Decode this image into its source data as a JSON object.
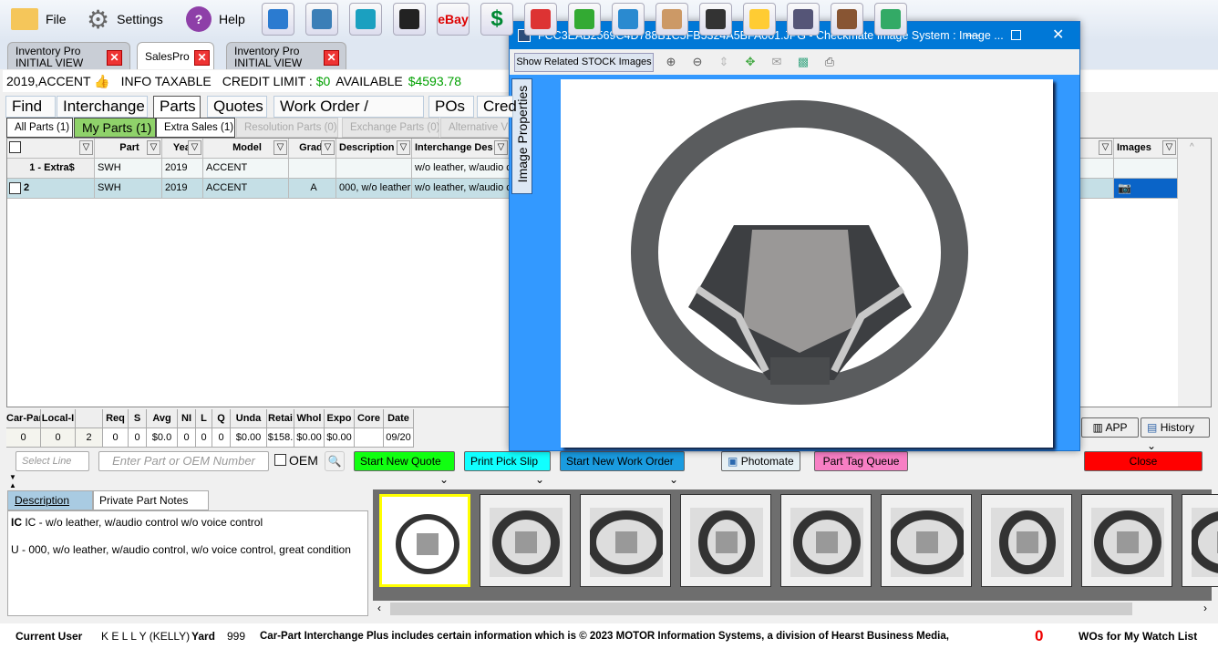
{
  "menu": {
    "file": "File",
    "settings": "Settings",
    "help": "Help"
  },
  "toolbar_icons": [
    "navigator-icon",
    "chart-icon",
    "images-icon",
    "terminal-icon",
    "ebay-icon",
    "dollar-icon",
    "red-app-icon",
    "green-app-icon",
    "report-icon",
    "agent-icon",
    "school-icon",
    "lock-icon",
    "register-icon",
    "clipboard-icon",
    "refresh-icon"
  ],
  "toolbar_text": {
    "ebay": "eBay",
    "dollar": "$"
  },
  "window_tabs": [
    {
      "line1": "Inventory Pro",
      "line2": "INITIAL VIEW"
    },
    {
      "line1": "SalesPro",
      "line2": ""
    },
    {
      "line1": "Inventory Pro",
      "line2": "INITIAL VIEW"
    }
  ],
  "info": {
    "vehicle": "2019,ACCENT",
    "taxable": "INFO TAXABLE",
    "credit_label": "CREDIT LIMIT :",
    "credit": "$0",
    "available_label": "AVAILABLE",
    "available": "$4593.78",
    "money_color": "#00a000"
  },
  "main_tabs": [
    "Find",
    "Interchange",
    "Parts",
    "Quotes",
    "Work Order / Invoice",
    "POs",
    "Cred"
  ],
  "sub_tabs": [
    "All Parts (1)",
    "My Parts (1)",
    "Extra Sales (1)",
    "Resolution Parts (0)",
    "Exchange Parts (0)",
    "Alternative Ve"
  ],
  "grid": {
    "headers": [
      "",
      "Part",
      "Year",
      "Model",
      "Grade",
      "Description",
      "Interchange Des",
      "nge",
      "Images"
    ],
    "rows": [
      [
        "1 - Extra$",
        "SWH",
        "2019",
        "ACCENT",
        "",
        "",
        "w/o leather, w/audio c",
        "",
        ""
      ],
      [
        "2",
        "SWH",
        "2019",
        "ACCENT",
        "A",
        "000, w/o leather",
        "w/o leather, w/audio c",
        "",
        ""
      ]
    ]
  },
  "stats": {
    "headers": [
      "Car-Part",
      "Local-I",
      "",
      "Req",
      "S",
      "Avg",
      "NI",
      "L",
      "Q",
      "Unda",
      "Retai",
      "Whol",
      "Expo",
      "Core",
      "Date"
    ],
    "values": [
      "0",
      "0",
      "2",
      "0",
      "0",
      "$0.0",
      "0",
      "0",
      "0",
      "$0.00",
      "$158.",
      "$0.00",
      "$0.00",
      "",
      "09/20"
    ]
  },
  "controls": {
    "select_line": "Select Line",
    "part_placeholder": "Enter Part or OEM Number",
    "oem": "OEM",
    "start_quote": "Start New Quote",
    "pick_slip": "Print Pick Slip",
    "work_order": "Start New Work Order",
    "photomate": "Photomate",
    "part_tag": "Part Tag Queue",
    "close": "Close",
    "app": "APP",
    "history": "History"
  },
  "desc_tabs": [
    "Description",
    "Private Part Notes"
  ],
  "description": {
    "ic": "IC - w/o leather, w/audio control w/o voice control",
    "u": "U - 000, w/o leather, w/audio control, w/o voice control, great condition"
  },
  "status": {
    "user_label": "Current User",
    "user": "K E L L Y (KELLY)",
    "yard_label": "Yard",
    "yard": "999",
    "copyright": "Car-Part Interchange Plus includes certain information which is © 2023 MOTOR Information Systems, a division of Hearst Business Media,",
    "watch_count": "0",
    "watch_label": "WOs for My Watch List"
  },
  "dialog": {
    "title": "FCC3EAB2569C4D788B1C5FB5324A5BFA001.JPG - Checkmate Image System : Image ...",
    "show_related": "Show Related STOCK Images",
    "properties_tab": "Image Properties",
    "tools": [
      "zoom-in-icon",
      "zoom-out-icon",
      "move-icon",
      "fit-icon",
      "email-icon",
      "image-icon",
      "print-icon"
    ]
  },
  "thumbnail_count": 9
}
